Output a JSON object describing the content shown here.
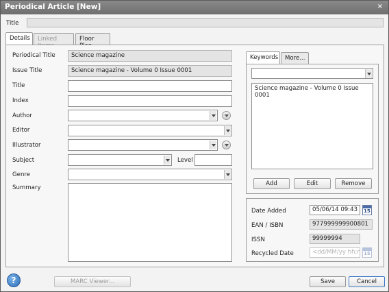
{
  "window": {
    "title": "Periodical Article [New]",
    "close": "×"
  },
  "top": {
    "title_label": "Title",
    "title_value": ""
  },
  "tabs": [
    {
      "label": "Details"
    },
    {
      "label": "Linked Items"
    },
    {
      "label": "Floor Plan"
    }
  ],
  "form": {
    "periodical_title_label": "Periodical Title",
    "periodical_title_value": "Science magazine",
    "issue_title_label": "Issue Title",
    "issue_title_value": "Science magazine - Volume 0 Issue 0001",
    "title_label": "Title",
    "title_value": "",
    "index_label": "Index",
    "index_value": "",
    "author_label": "Author",
    "editor_label": "Editor",
    "illustrator_label": "Illustrator",
    "subject_label": "Subject",
    "level_label": "Level",
    "level_value": "",
    "genre_label": "Genre",
    "summary_label": "Summary",
    "summary_value": ""
  },
  "keywords": {
    "tab_label": "Keywords",
    "more_label": "More...",
    "items": [
      "Science magazine - Volume 0 Issue 0001"
    ],
    "add": "Add",
    "edit": "Edit",
    "remove": "Remove"
  },
  "info": {
    "date_added_label": "Date Added",
    "date_added_value": "05/06/14 09:43",
    "ean_label": "EAN / ISBN",
    "ean_value": "977999999900801",
    "issn_label": "ISSN",
    "issn_value": "99999994",
    "recycled_label": "Recycled Date",
    "recycled_placeholder": "<dd/MM/yy hh:mm>",
    "calendar_day": "15"
  },
  "footer": {
    "help": "?",
    "marc": "MARC Viewer...",
    "save": "Save",
    "cancel": "Cancel"
  }
}
